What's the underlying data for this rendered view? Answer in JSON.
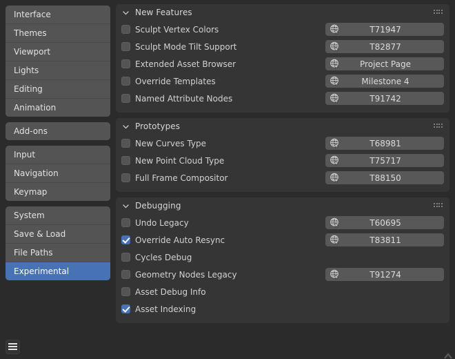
{
  "sidebar": {
    "groups": [
      {
        "items": [
          {
            "label": "Interface",
            "selected": false
          },
          {
            "label": "Themes",
            "selected": false
          },
          {
            "label": "Viewport",
            "selected": false
          },
          {
            "label": "Lights",
            "selected": false
          },
          {
            "label": "Editing",
            "selected": false
          },
          {
            "label": "Animation",
            "selected": false
          }
        ]
      },
      {
        "items": [
          {
            "label": "Add-ons",
            "selected": false
          }
        ]
      },
      {
        "items": [
          {
            "label": "Input",
            "selected": false
          },
          {
            "label": "Navigation",
            "selected": false
          },
          {
            "label": "Keymap",
            "selected": false
          }
        ]
      },
      {
        "items": [
          {
            "label": "System",
            "selected": false
          },
          {
            "label": "Save & Load",
            "selected": false
          },
          {
            "label": "File Paths",
            "selected": false
          },
          {
            "label": "Experimental",
            "selected": true
          }
        ]
      }
    ]
  },
  "panels": [
    {
      "title": "New Features",
      "expanded": true,
      "grip_icon": "grip-dots-icon",
      "chevron_icon": "chevron-down-icon",
      "rows": [
        {
          "label": "Sculpt Vertex Colors",
          "checked": false,
          "link": {
            "text": "T71947",
            "icon": "globe-link-icon"
          }
        },
        {
          "label": "Sculpt Mode Tilt Support",
          "checked": false,
          "link": {
            "text": "T82877",
            "icon": "globe-link-icon"
          }
        },
        {
          "label": "Extended Asset Browser",
          "checked": false,
          "link": {
            "text": "Project Page",
            "icon": "globe-link-icon"
          }
        },
        {
          "label": "Override Templates",
          "checked": false,
          "link": {
            "text": "Milestone 4",
            "icon": "globe-link-icon"
          }
        },
        {
          "label": "Named Attribute Nodes",
          "checked": false,
          "link": {
            "text": "T91742",
            "icon": "globe-link-icon"
          }
        }
      ]
    },
    {
      "title": "Prototypes",
      "expanded": true,
      "grip_icon": "grip-dots-icon",
      "chevron_icon": "chevron-down-icon",
      "rows": [
        {
          "label": "New Curves Type",
          "checked": false,
          "link": {
            "text": "T68981",
            "icon": "globe-link-icon"
          }
        },
        {
          "label": "New Point Cloud Type",
          "checked": false,
          "link": {
            "text": "T75717",
            "icon": "globe-link-icon"
          }
        },
        {
          "label": "Full Frame Compositor",
          "checked": false,
          "link": {
            "text": "T88150",
            "icon": "globe-link-icon"
          }
        }
      ]
    },
    {
      "title": "Debugging",
      "expanded": true,
      "grip_icon": "grip-dots-icon",
      "chevron_icon": "chevron-down-icon",
      "rows": [
        {
          "label": "Undo Legacy",
          "checked": false,
          "link": {
            "text": "T60695",
            "icon": "globe-link-icon"
          }
        },
        {
          "label": "Override Auto Resync",
          "checked": true,
          "link": {
            "text": "T83811",
            "icon": "globe-link-icon"
          }
        },
        {
          "label": "Cycles Debug",
          "checked": false,
          "link": null
        },
        {
          "label": "Geometry Nodes Legacy",
          "checked": false,
          "link": {
            "text": "T91274",
            "icon": "globe-link-icon"
          }
        },
        {
          "label": "Asset Debug Info",
          "checked": false,
          "link": null
        },
        {
          "label": "Asset Indexing",
          "checked": true,
          "link": null
        }
      ]
    }
  ],
  "bottom_bar": {
    "menu_icon": "hamburger-menu-icon",
    "resize_icon": "resize-corner-icon"
  },
  "colors": {
    "window_bg": "#2b2b2b",
    "panel_bg": "#353535",
    "nav_item_bg": "#545454",
    "accent_blue": "#4772b3",
    "text": "#d2d2d2",
    "link_button_bg": "#585858"
  }
}
